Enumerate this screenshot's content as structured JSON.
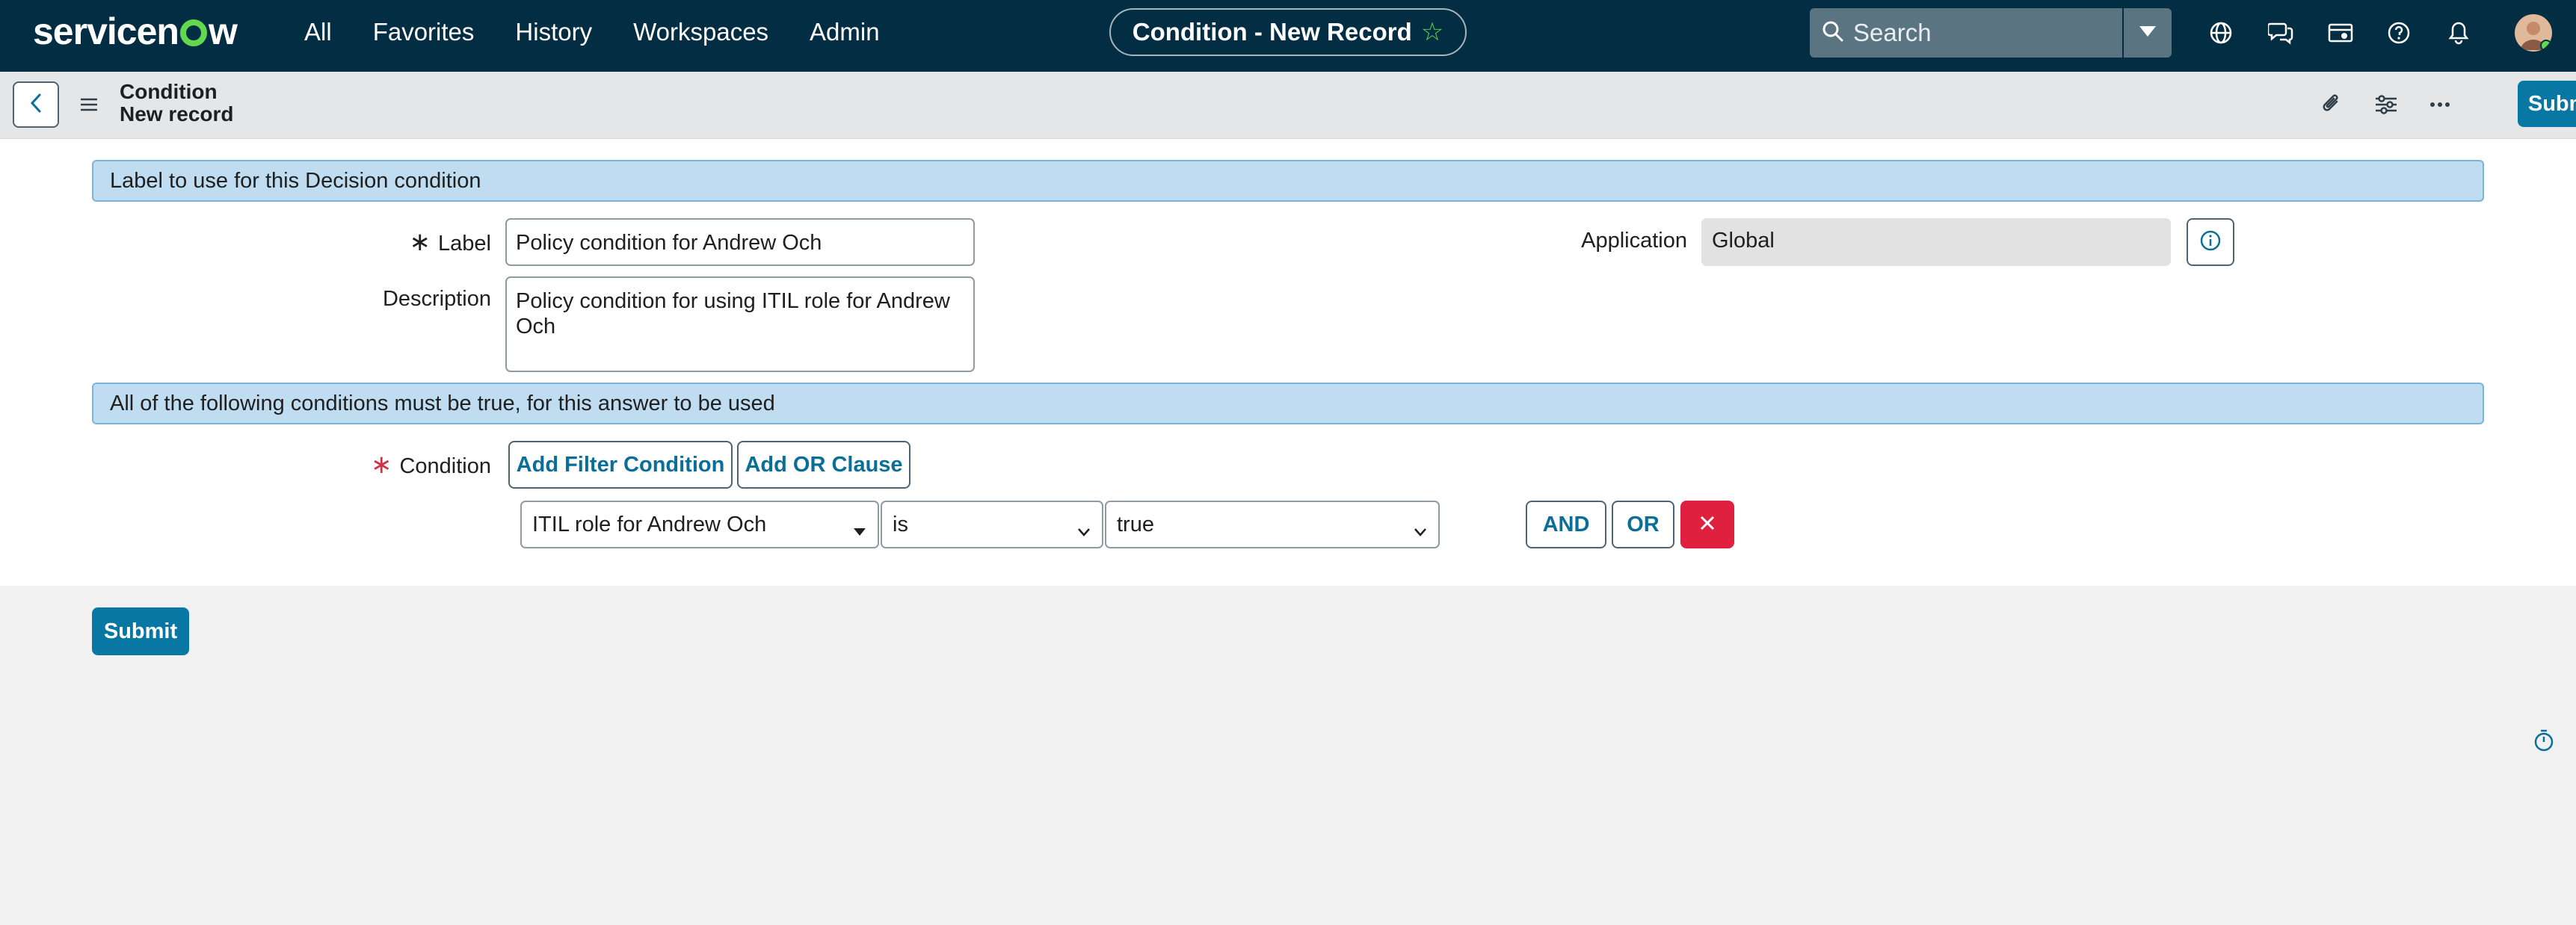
{
  "nav": {
    "logo": "servicenow",
    "links": [
      "All",
      "Favorites",
      "History",
      "Workspaces",
      "Admin"
    ],
    "record_title": "Condition - New Record",
    "search_placeholder": "Search",
    "icons": [
      "globe-icon",
      "chat-icon",
      "card-icon",
      "help-icon",
      "bell-icon"
    ]
  },
  "header": {
    "table_name": "Condition",
    "record_state": "New record",
    "submit_label": "Submit",
    "icons": [
      "paperclip-icon",
      "sliders-icon",
      "more-icon"
    ]
  },
  "form": {
    "section1": "Label to use for this Decision condition",
    "label_label": "Label",
    "label_value": "Policy condition for Andrew Och",
    "description_label": "Description",
    "description_value": "Policy condition for using ITIL role for Andrew Och",
    "application_label": "Application",
    "application_value": "Global",
    "section2": "All of the following conditions must be true, for this answer to be used",
    "condition_label": "Condition",
    "add_filter_label": "Add Filter Condition",
    "add_or_label": "Add OR Clause",
    "filter": {
      "field": "ITIL role for Andrew Och",
      "operator": "is",
      "value": "true"
    },
    "and_label": "AND",
    "or_label": "OR",
    "submit_label": "Submit"
  },
  "colors": {
    "nav_bg": "#032d42",
    "accent": "#0877a3",
    "brand_green": "#62d84e",
    "section_bg": "#bfdcf0",
    "delete_red": "#e0203f"
  }
}
